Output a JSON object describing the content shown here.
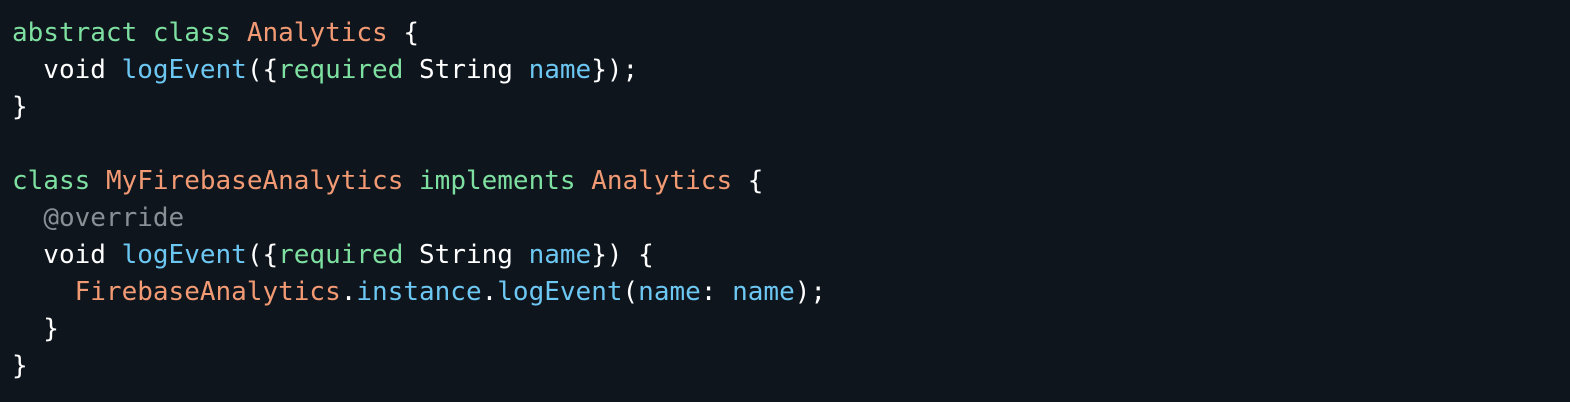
{
  "colors": {
    "background": "#0f151d",
    "plain": "#ffffff",
    "keyword": "#7ee0a0",
    "type": "#f29a73",
    "member": "#6cc7f2",
    "annotation": "#8a8f96"
  },
  "code": {
    "lines": [
      [
        {
          "text": "abstract",
          "kind": "keyword"
        },
        {
          "text": " ",
          "kind": "plain"
        },
        {
          "text": "class",
          "kind": "keyword"
        },
        {
          "text": " ",
          "kind": "plain"
        },
        {
          "text": "Analytics",
          "kind": "type"
        },
        {
          "text": " {",
          "kind": "plain"
        }
      ],
      [
        {
          "text": "  void ",
          "kind": "plain"
        },
        {
          "text": "logEvent",
          "kind": "member"
        },
        {
          "text": "({",
          "kind": "plain"
        },
        {
          "text": "required",
          "kind": "keyword"
        },
        {
          "text": " String ",
          "kind": "plain"
        },
        {
          "text": "name",
          "kind": "member"
        },
        {
          "text": "});",
          "kind": "plain"
        }
      ],
      [
        {
          "text": "}",
          "kind": "plain"
        }
      ],
      [],
      [
        {
          "text": "class",
          "kind": "keyword"
        },
        {
          "text": " ",
          "kind": "plain"
        },
        {
          "text": "MyFirebaseAnalytics",
          "kind": "type"
        },
        {
          "text": " ",
          "kind": "plain"
        },
        {
          "text": "implements",
          "kind": "keyword"
        },
        {
          "text": " ",
          "kind": "plain"
        },
        {
          "text": "Analytics",
          "kind": "type"
        },
        {
          "text": " {",
          "kind": "plain"
        }
      ],
      [
        {
          "text": "  ",
          "kind": "plain"
        },
        {
          "text": "@override",
          "kind": "annotation"
        }
      ],
      [
        {
          "text": "  void ",
          "kind": "plain"
        },
        {
          "text": "logEvent",
          "kind": "member"
        },
        {
          "text": "({",
          "kind": "plain"
        },
        {
          "text": "required",
          "kind": "keyword"
        },
        {
          "text": " String ",
          "kind": "plain"
        },
        {
          "text": "name",
          "kind": "member"
        },
        {
          "text": "}) {",
          "kind": "plain"
        }
      ],
      [
        {
          "text": "    ",
          "kind": "plain"
        },
        {
          "text": "FirebaseAnalytics",
          "kind": "type"
        },
        {
          "text": ".",
          "kind": "plain"
        },
        {
          "text": "instance",
          "kind": "member"
        },
        {
          "text": ".",
          "kind": "plain"
        },
        {
          "text": "logEvent",
          "kind": "member"
        },
        {
          "text": "(",
          "kind": "plain"
        },
        {
          "text": "name",
          "kind": "member"
        },
        {
          "text": ": ",
          "kind": "plain"
        },
        {
          "text": "name",
          "kind": "member"
        },
        {
          "text": ");",
          "kind": "plain"
        }
      ],
      [
        {
          "text": "  }",
          "kind": "plain"
        }
      ],
      [
        {
          "text": "}",
          "kind": "plain"
        }
      ]
    ]
  }
}
